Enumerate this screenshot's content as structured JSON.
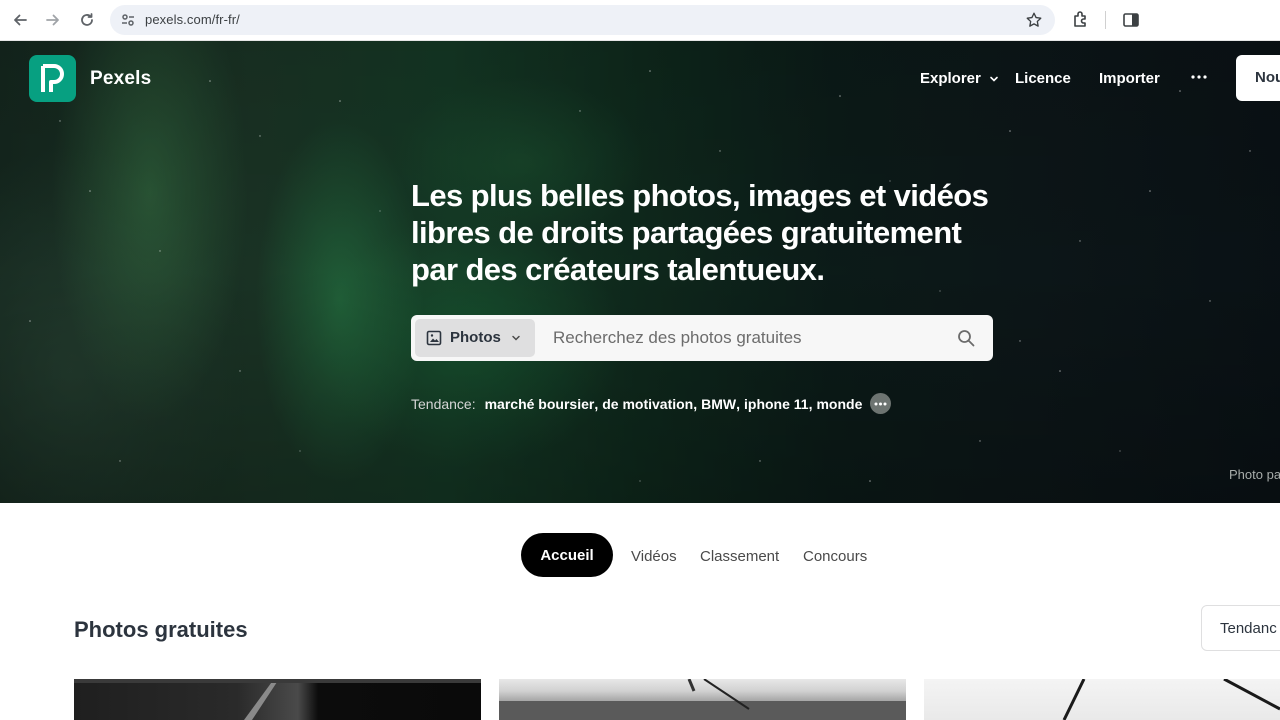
{
  "browser": {
    "url": "pexels.com/fr-fr/"
  },
  "header": {
    "brand": "Pexels",
    "nav": {
      "explore": "Explorer",
      "license": "Licence",
      "upload": "Importer",
      "join": "Nou"
    }
  },
  "hero": {
    "headline": "Les plus belles photos, images et vidéos libres de droits partagées gratuitement par des créateurs talentueux.",
    "search": {
      "type_label": "Photos",
      "placeholder": "Recherchez des photos gratuites"
    },
    "trending": {
      "label": "Tendance:",
      "items": [
        "marché boursier",
        "de motivation",
        "BMW",
        "iphone 11",
        "monde"
      ]
    },
    "credit": "Photo pa"
  },
  "tabs": {
    "home": "Accueil",
    "videos": "Vidéos",
    "leaderboard": "Classement",
    "challenges": "Concours"
  },
  "main": {
    "title": "Photos gratuites",
    "sort_label": "Tendanc"
  },
  "colors": {
    "brand": "#07a081",
    "active_tab": "#000000"
  }
}
